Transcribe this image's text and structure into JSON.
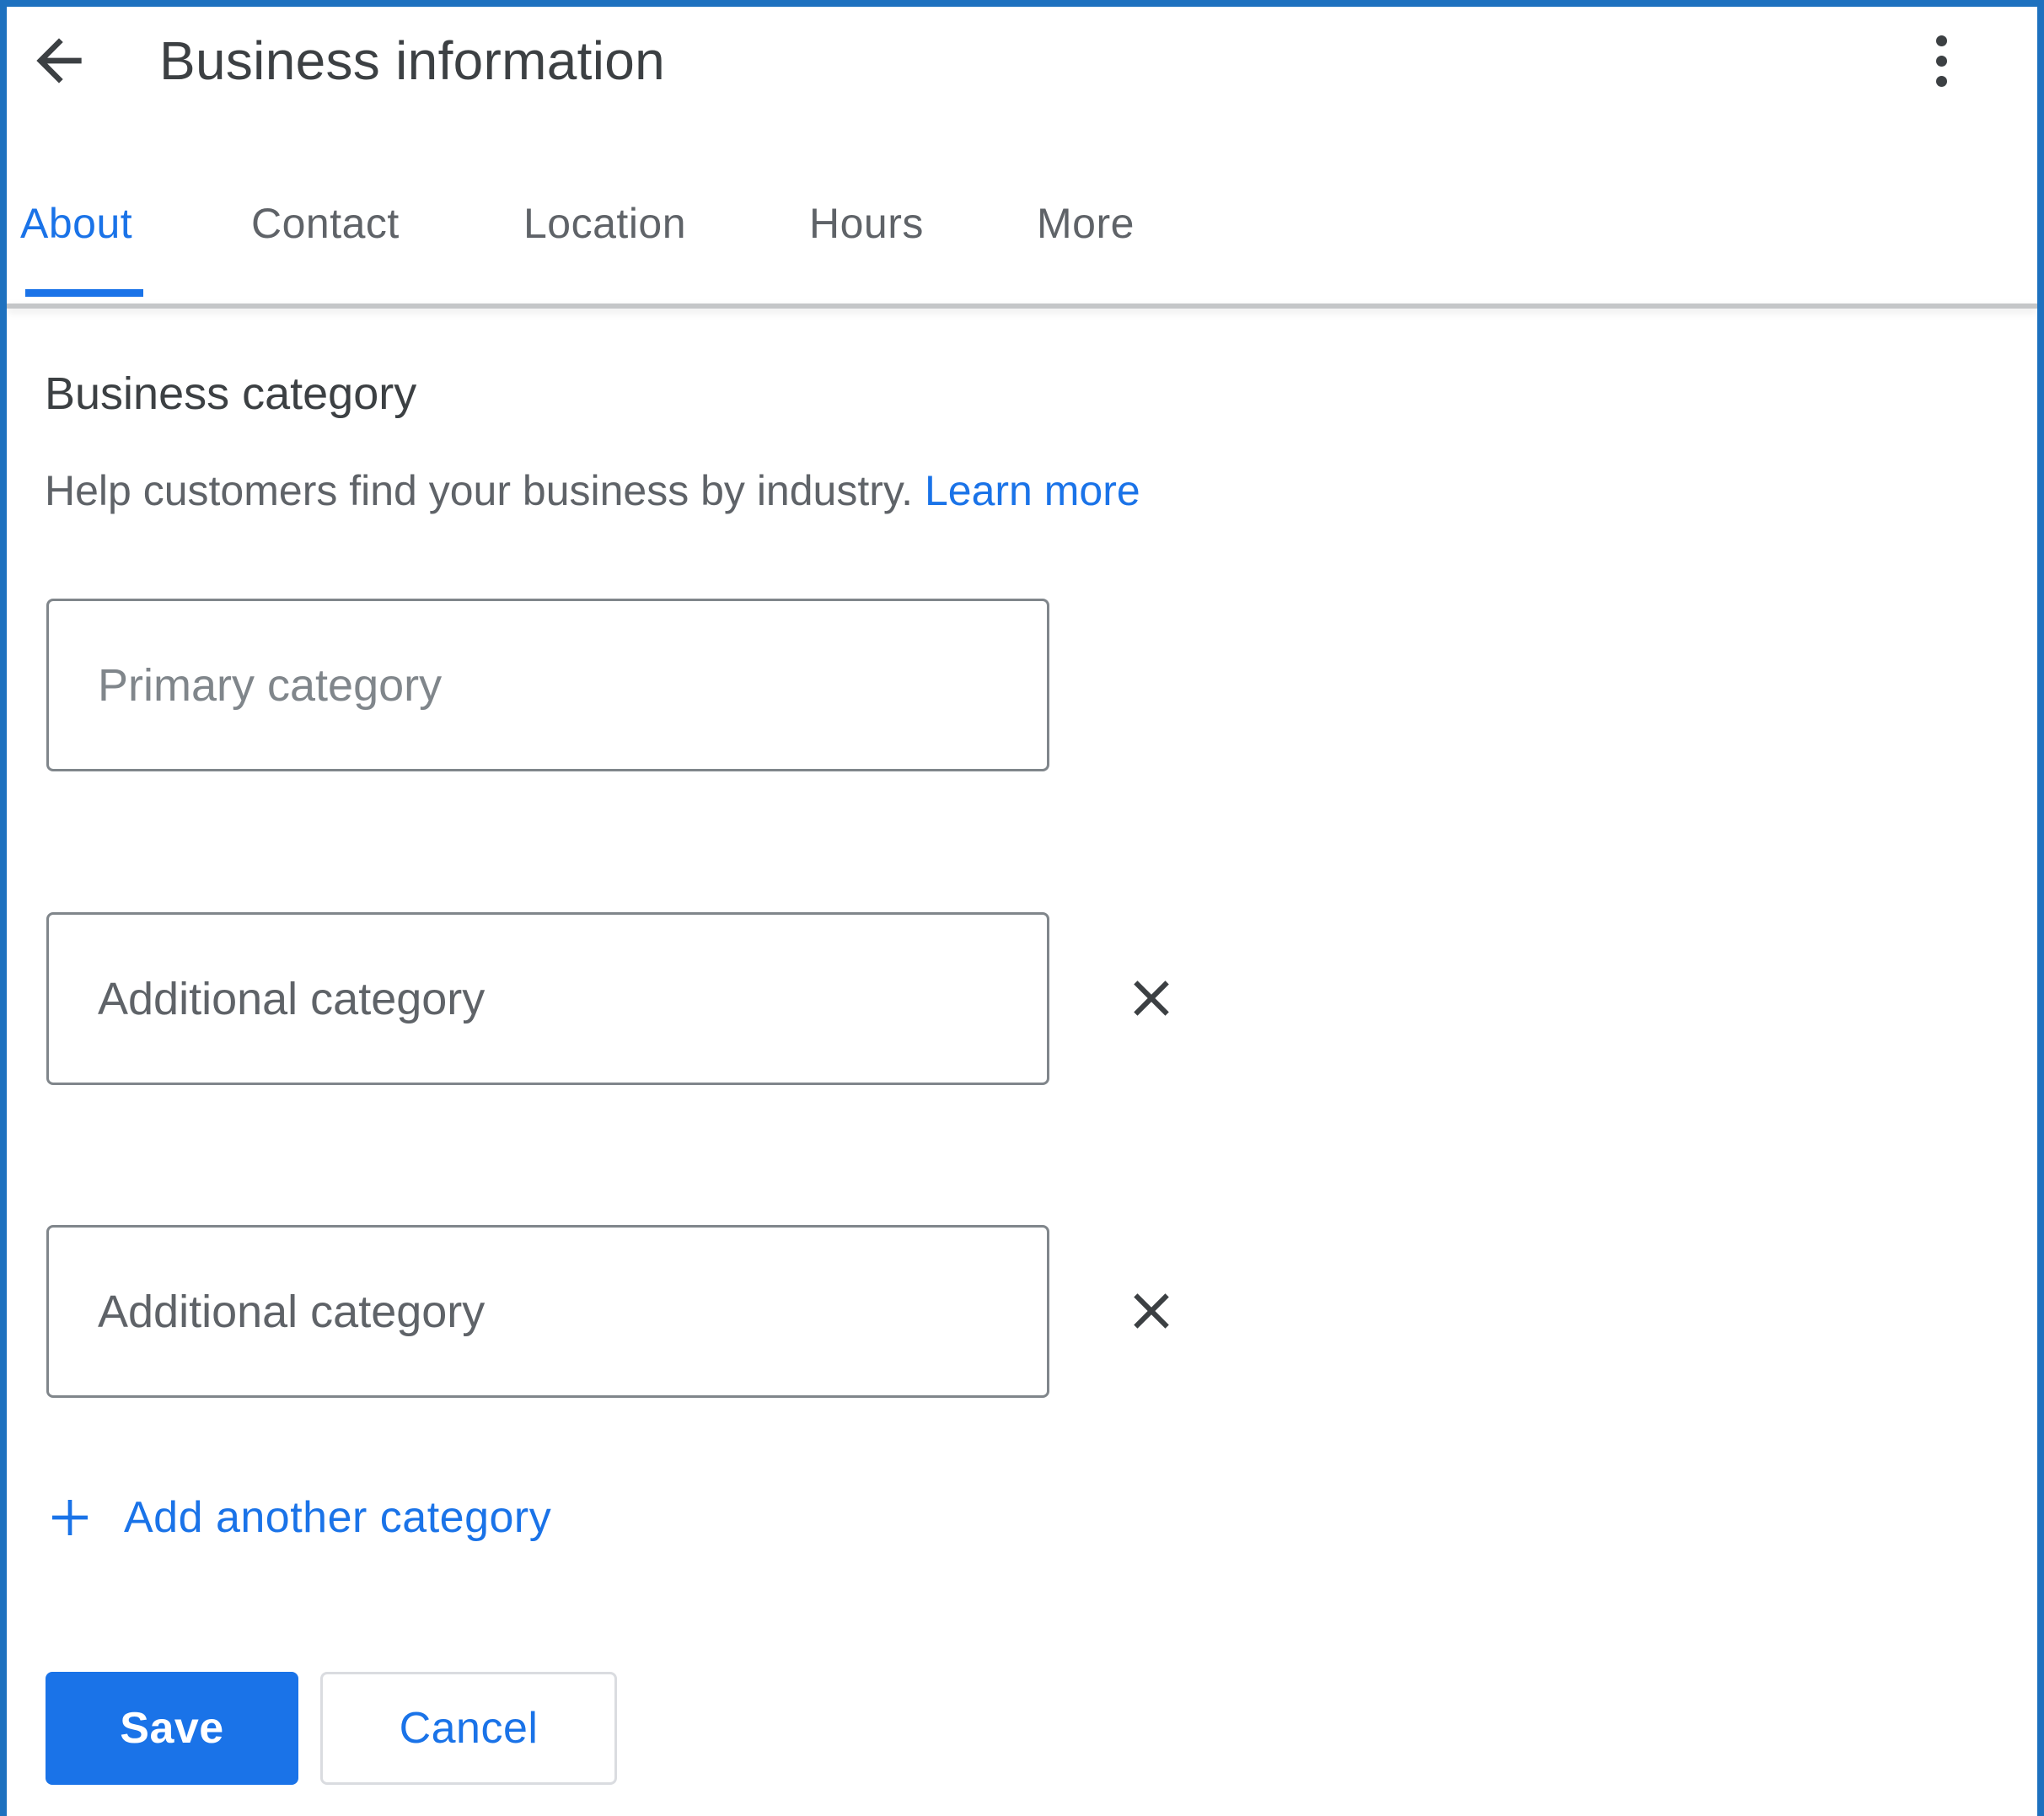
{
  "header": {
    "title": "Business information",
    "back_icon": "arrow-left-icon",
    "menu_icon": "more-vert-icon"
  },
  "tabs": [
    {
      "label": "About",
      "active": true
    },
    {
      "label": "Contact",
      "active": false
    },
    {
      "label": "Location",
      "active": false
    },
    {
      "label": "Hours",
      "active": false
    },
    {
      "label": "More",
      "active": false
    }
  ],
  "section": {
    "title": "Business category",
    "help_text": "Help customers find your business by industry. ",
    "learn_more": "Learn more"
  },
  "fields": [
    {
      "placeholder": "Primary category",
      "value": "",
      "removable": false
    },
    {
      "placeholder": "Additional category",
      "value": "",
      "removable": true
    },
    {
      "placeholder": "Additional category",
      "value": "",
      "removable": true
    }
  ],
  "add_link": {
    "label": "Add another category",
    "icon": "plus-icon"
  },
  "actions": {
    "save": "Save",
    "cancel": "Cancel"
  },
  "colors": {
    "accent": "#1a73e8",
    "frame": "#1d71bf",
    "text": "#3c4043",
    "muted": "#5f6368"
  }
}
